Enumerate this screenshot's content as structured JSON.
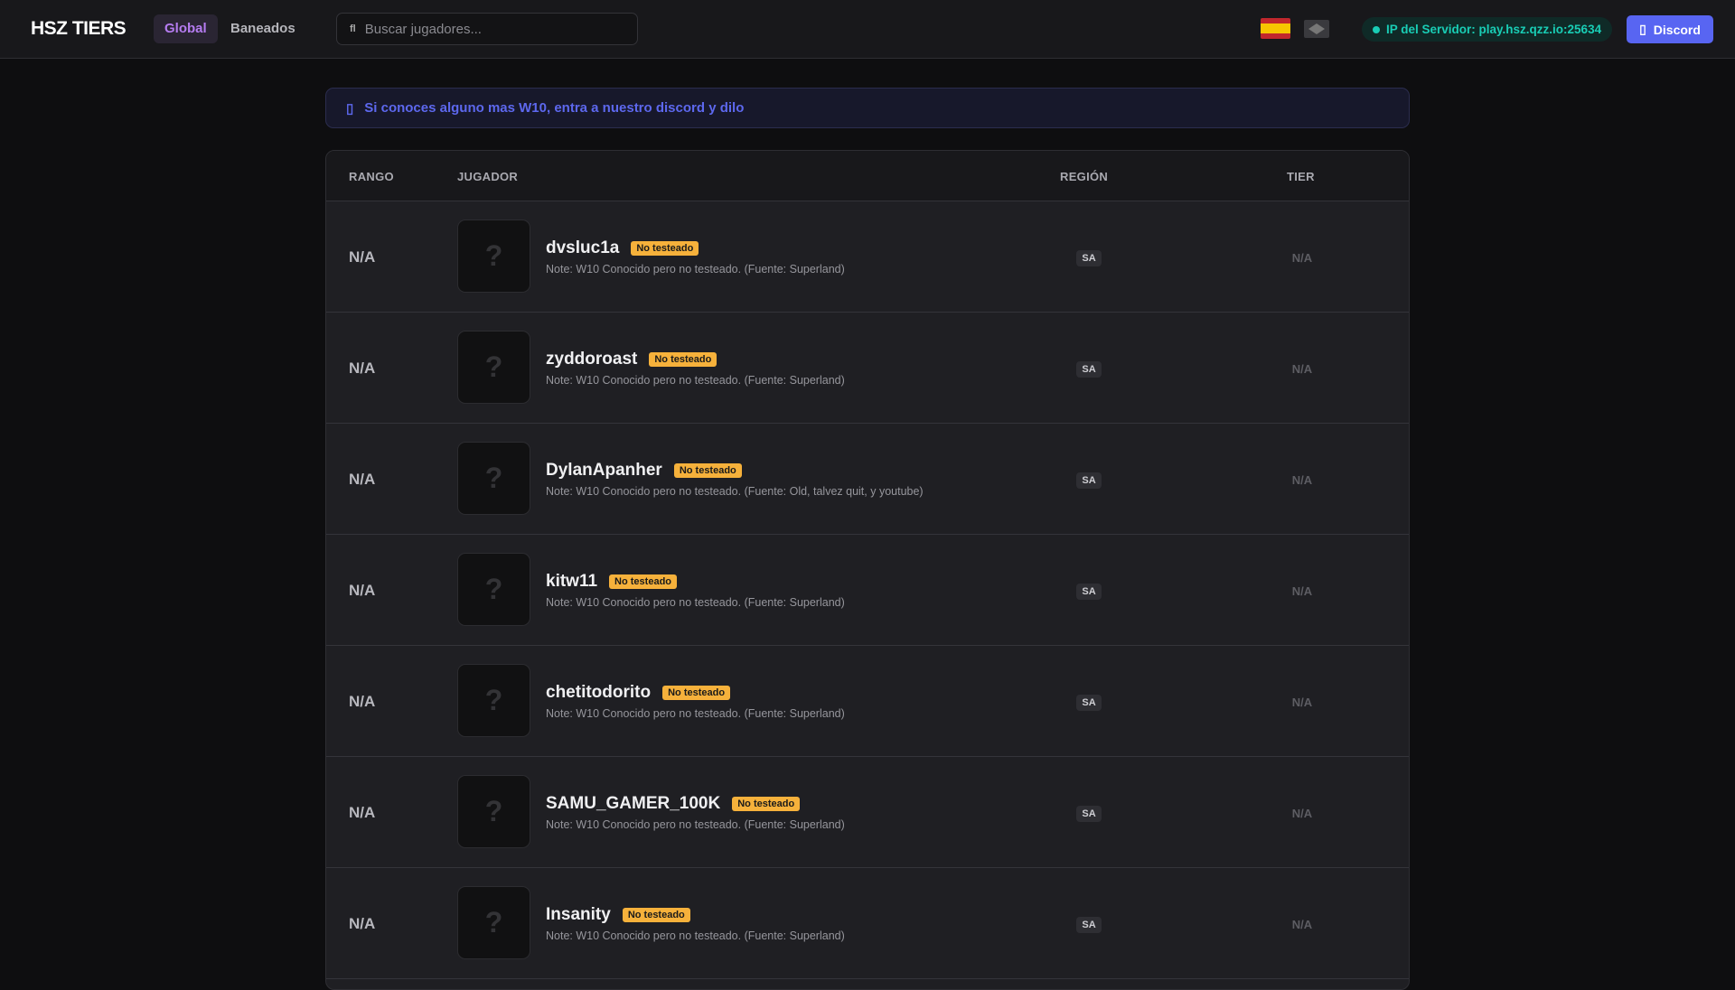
{
  "header": {
    "logo": "HSZ TIERS",
    "tabs": [
      {
        "label": "Global"
      },
      {
        "label": "Baneados"
      }
    ],
    "search": {
      "icon": "fl",
      "placeholder": "Buscar jugadores..."
    },
    "server_ip": "IP del Servidor: play.hsz.qzz.io:25634",
    "discord_label": "Discord",
    "colors": {
      "accent": "#b57cf0",
      "discord": "#5865f2",
      "ip": "#19cdb5"
    }
  },
  "banner": {
    "text": "Si conoces alguno mas W10, entra a nuestro discord y dilo"
  },
  "table": {
    "columns": [
      "RANGO",
      "JUGADOR",
      "REGIÓN",
      "TIER"
    ],
    "rows": [
      {
        "rank": "N/A",
        "avatar": "?",
        "name": "dvsluc1a",
        "badge": "No testeado",
        "note": "Note: W10 Conocido pero no testeado. (Fuente: Superland)",
        "region": "SA",
        "tier": "N/A"
      },
      {
        "rank": "N/A",
        "avatar": "?",
        "name": "zyddoroast",
        "badge": "No testeado",
        "note": "Note: W10 Conocido pero no testeado. (Fuente: Superland)",
        "region": "SA",
        "tier": "N/A"
      },
      {
        "rank": "N/A",
        "avatar": "?",
        "name": "DylanApanher",
        "badge": "No testeado",
        "note": "Note: W10 Conocido pero no testeado. (Fuente: Old, talvez quit, y youtube)",
        "region": "SA",
        "tier": "N/A"
      },
      {
        "rank": "N/A",
        "avatar": "?",
        "name": "kitw11",
        "badge": "No testeado",
        "note": "Note: W10 Conocido pero no testeado. (Fuente: Superland)",
        "region": "SA",
        "tier": "N/A"
      },
      {
        "rank": "N/A",
        "avatar": "?",
        "name": "chetitodorito",
        "badge": "No testeado",
        "note": "Note: W10 Conocido pero no testeado. (Fuente: Superland)",
        "region": "SA",
        "tier": "N/A"
      },
      {
        "rank": "N/A",
        "avatar": "?",
        "name": "SAMU_GAMER_100K",
        "badge": "No testeado",
        "note": "Note: W10 Conocido pero no testeado. (Fuente: Superland)",
        "region": "SA",
        "tier": "N/A"
      },
      {
        "rank": "N/A",
        "avatar": "?",
        "name": "Insanity",
        "badge": "No testeado",
        "note": "Note: W10 Conocido pero no testeado. (Fuente: Superland)",
        "region": "SA",
        "tier": "N/A"
      }
    ]
  }
}
